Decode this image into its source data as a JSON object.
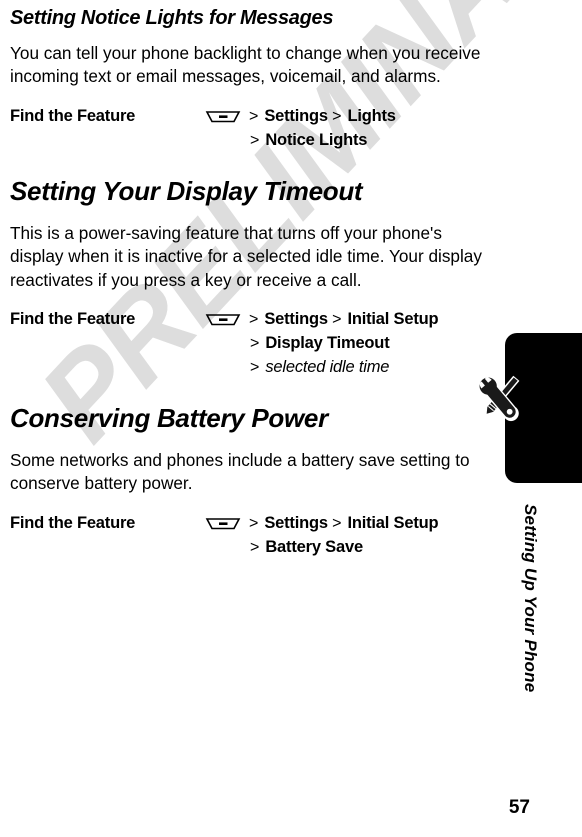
{
  "page": {
    "number": "57",
    "watermark": "PRELIMINARY",
    "watermark_color": "#dddddd",
    "side_tab_title": "Setting Up Your Phone",
    "side_tab_color": "#000000",
    "side_tab_icon": "wrench-screwdriver-icon"
  },
  "sections": [
    {
      "heading": "Setting Notice Lights for Messages",
      "body": "You can tell your phone backlight to change when you receive incoming text or email messages, voicemail, and alarms.",
      "find_feature": {
        "label": "Find the Feature",
        "icon": "menu-softkey-icon",
        "lines": [
          {
            "indent": false,
            "parts": [
              {
                "chevron": ">",
                "text": "Settings",
                "style": "bold"
              },
              {
                "chevron": ">",
                "text": "Lights",
                "style": "bold"
              }
            ]
          },
          {
            "indent": true,
            "parts": [
              {
                "chevron": ">",
                "text": "Notice Lights",
                "style": "bold"
              }
            ]
          }
        ]
      }
    },
    {
      "heading": "Setting Your Display Timeout",
      "body": "This is a power-saving feature that turns off your phone's display when it is inactive for a selected idle time. Your display reactivates if you press a key or receive a call.",
      "find_feature": {
        "label": "Find the Feature",
        "icon": "menu-softkey-icon",
        "lines": [
          {
            "indent": false,
            "parts": [
              {
                "chevron": ">",
                "text": "Settings",
                "style": "bold"
              },
              {
                "chevron": ">",
                "text": "Initial Setup",
                "style": "bold"
              }
            ]
          },
          {
            "indent": true,
            "parts": [
              {
                "chevron": ">",
                "text": "Display Timeout",
                "style": "bold"
              }
            ]
          },
          {
            "indent": true,
            "parts": [
              {
                "chevron": ">",
                "text": "selected idle time",
                "style": "italic"
              }
            ]
          }
        ]
      }
    },
    {
      "heading": "Conserving Battery Power",
      "body": "Some networks and phones include a battery save setting to conserve battery power.",
      "find_feature": {
        "label": "Find the Feature",
        "icon": "menu-softkey-icon",
        "lines": [
          {
            "indent": false,
            "parts": [
              {
                "chevron": ">",
                "text": "Settings",
                "style": "bold"
              },
              {
                "chevron": ">",
                "text": "Initial Setup",
                "style": "bold"
              }
            ]
          },
          {
            "indent": true,
            "parts": [
              {
                "chevron": ">",
                "text": "Battery Save",
                "style": "bold"
              }
            ]
          }
        ]
      }
    }
  ]
}
